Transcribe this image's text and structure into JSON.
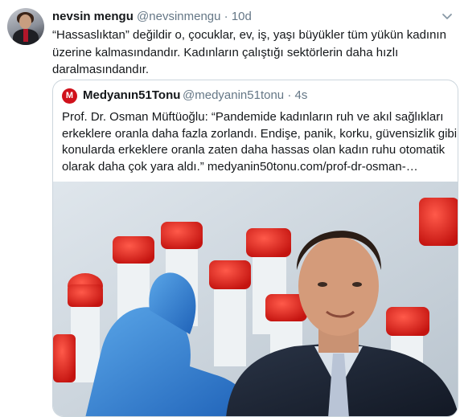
{
  "tweet": {
    "author_name": "nevsin mengu",
    "author_handle": "@nevsinmengu",
    "separator": "·",
    "time": "10d",
    "text_lines": [
      "“Hassaslıktan” değildir o, çocuklar, ev, iş, yaşı büyükler tüm yükün kadının",
      "üzerine kalmasındandır. Kadınların çalıştığı sektörlerin daha hızlı",
      "daralmasındandır."
    ],
    "menu_icon": "chevron-down-icon"
  },
  "quoted": {
    "logo_letter": "M",
    "author_name": "Medyanın51Tonu",
    "author_handle": "@medyanin51tonu",
    "separator": "·",
    "time": "4s",
    "text_lines": [
      "Prof. Dr. Osman Müftüoğlu: “Pandemide kadınların ruh ve akıl sağlıkları",
      "erkeklere oranla daha fazla zorlandı. Endişe, panik, korku, güvensizlik gibi",
      "konularda erkeklere oranla zaten daha hassas olan kadın ruhu otomatik",
      "olarak daha çok yara aldı.” medyanin50tonu.com/prof-dr-osman-…"
    ],
    "colors": {
      "brand": "#d0111b",
      "secondary_text": "#657786",
      "border": "#ccd6dd"
    }
  }
}
